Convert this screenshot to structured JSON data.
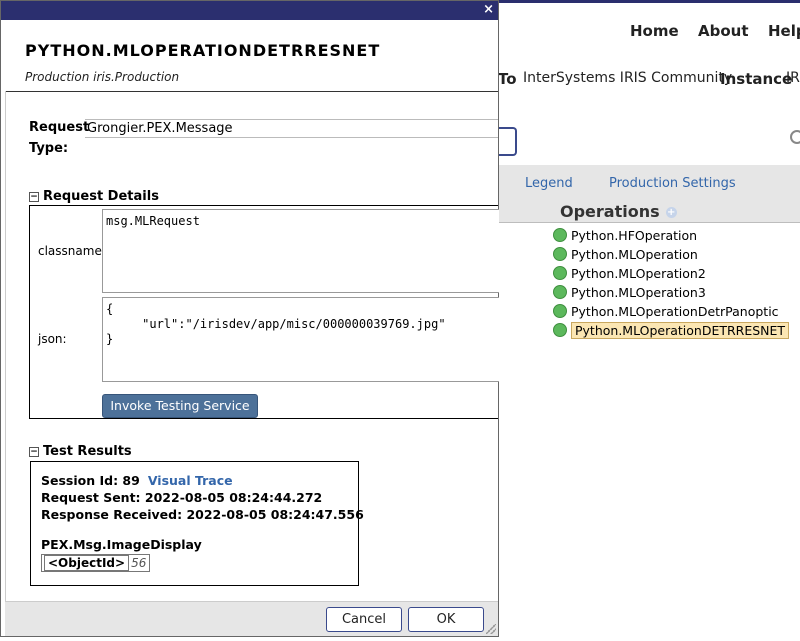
{
  "background": {
    "nav": {
      "home": "Home",
      "about": "About",
      "help": "Help"
    },
    "row2": {
      "to_label": "To",
      "to_value": "InterSystems IRIS Community",
      "instance_label": "Instance",
      "instance_value": "IRIS"
    },
    "links": {
      "legend": "Legend",
      "production_settings": "Production Settings"
    },
    "operations_heading": "Operations",
    "operations": [
      {
        "label": "Python.HFOperation",
        "status": "green"
      },
      {
        "label": "Python.MLOperation",
        "status": "green"
      },
      {
        "label": "Python.MLOperation2",
        "status": "green"
      },
      {
        "label": "Python.MLOperation3",
        "status": "green"
      },
      {
        "label": "Python.MLOperationDetrPanoptic",
        "status": "green"
      },
      {
        "label": "Python.MLOperationDETRRESNET",
        "status": "green",
        "selected": true
      }
    ]
  },
  "dialog": {
    "close_icon": "×",
    "title": "PYTHON.MLOPERATIONDETRRESNET",
    "subtitle": "Production iris.Production",
    "request_type_label_1": "Request",
    "request_type_label_2": "Type:",
    "request_type_value": "Grongier.PEX.Message",
    "request_details": {
      "heading": "Request Details",
      "toggle": "−",
      "classname_label": "classname:",
      "classname_value": "msg.MLRequest",
      "json_label": "json:",
      "json_value": "{\n     \"url\":\"/irisdev/app/misc/000000039769.jpg\"\n}",
      "invoke_button": "Invoke Testing Service"
    },
    "test_results": {
      "heading": "Test Results",
      "toggle": "−",
      "session_label": "Session Id: 89",
      "visual_trace": "Visual Trace",
      "request_sent": "Request Sent: 2022-08-05 08:24:44.272",
      "response_received": "Response Received: 2022-08-05 08:24:47.556",
      "message_class": "PEX.Msg.ImageDisplay",
      "objectid_key": "<ObjectId>",
      "objectid_value": "56"
    },
    "buttons": {
      "cancel": "Cancel",
      "ok": "OK"
    }
  },
  "colors": {
    "titlebar": "#2b2f6f",
    "accent_button": "#4d7199",
    "status_green": "#5cb85c",
    "selected_highlight": "#fbe6b3",
    "link": "#3366aa"
  }
}
